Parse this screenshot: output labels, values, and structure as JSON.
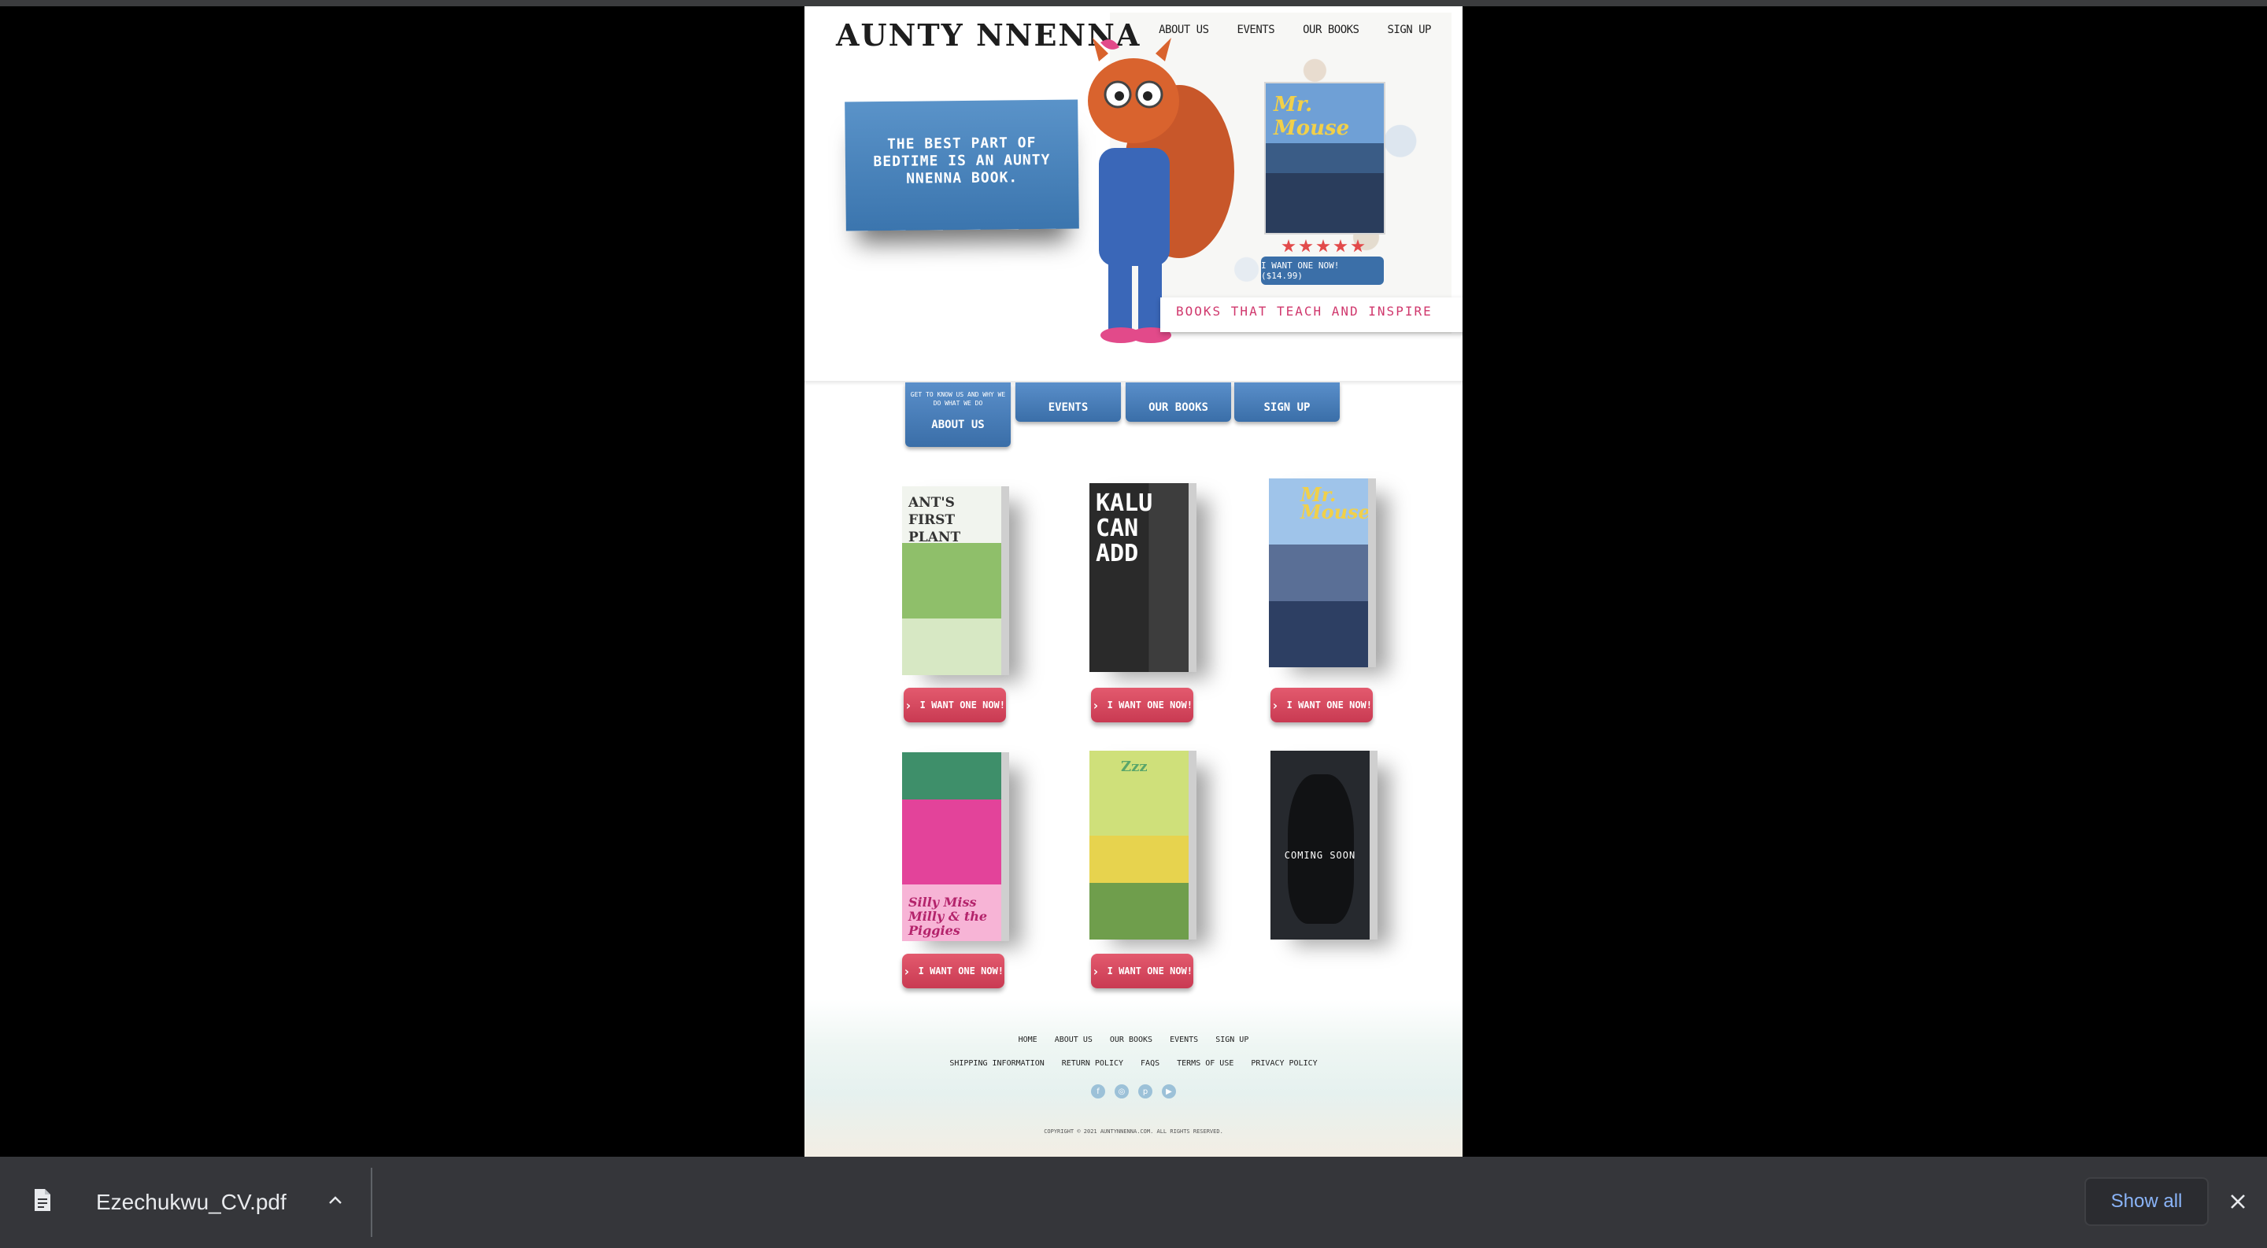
{
  "site": {
    "logo": "AUNTY NNENNA",
    "nav": [
      "ABOUT US",
      "EVENTS",
      "OUR BOOKS",
      "SIGN UP"
    ],
    "hero": {
      "card_text": "THE BEST PART OF BEDTIME IS AN AUNTY NNENNA BOOK.",
      "featured_book_title": "Mr. Mouse",
      "stars": 5,
      "buy_label": "I WANT ONE NOW! ($14.99)",
      "tagline": "BOOKS THAT TEACH AND INSPIRE"
    },
    "tabs": {
      "about_hint": "GET TO KNOW US AND WHY WE DO WHAT WE DO",
      "about": "ABOUT US",
      "events": "EVENTS",
      "books": "OUR BOOKS",
      "signup": "SIGN UP"
    },
    "books": [
      {
        "title": "ANT'S FIRST PLANT",
        "buy": "I WANT ONE NOW!"
      },
      {
        "title": "KALU CAN ADD",
        "buy": "I WANT ONE NOW!"
      },
      {
        "title": "Mr. Mouse",
        "buy": "I WANT ONE NOW!"
      },
      {
        "title": "Silly Miss Milly & the Piggies",
        "buy": "I WANT ONE NOW!"
      },
      {
        "title": "Zzz",
        "buy": "I WANT ONE NOW!"
      },
      {
        "title": "COMING SOON"
      }
    ],
    "footer": {
      "row1": [
        "HOME",
        "ABOUT US",
        "OUR BOOKS",
        "EVENTS",
        "SIGN UP"
      ],
      "row2": [
        "SHIPPING INFORMATION",
        "RETURN POLICY",
        "FAQS",
        "TERMS OF USE",
        "PRIVACY POLICY"
      ],
      "socials": [
        "facebook-icon",
        "instagram-icon",
        "pinterest-icon",
        "youtube-icon"
      ],
      "copyright": "COPYRIGHT © 2021 AUNTYNNENNA.COM. ALL RIGHTS RESERVED."
    }
  },
  "download_bar": {
    "filename": "Ezechukwu_CV.pdf",
    "show_all": "Show all"
  },
  "colors": {
    "brand_blue": "#3b75ae",
    "buy_red": "#c93a52",
    "tagline_pink": "#d0386d",
    "download_bar_bg": "#35363a",
    "link_blue": "#8ab4f8"
  }
}
